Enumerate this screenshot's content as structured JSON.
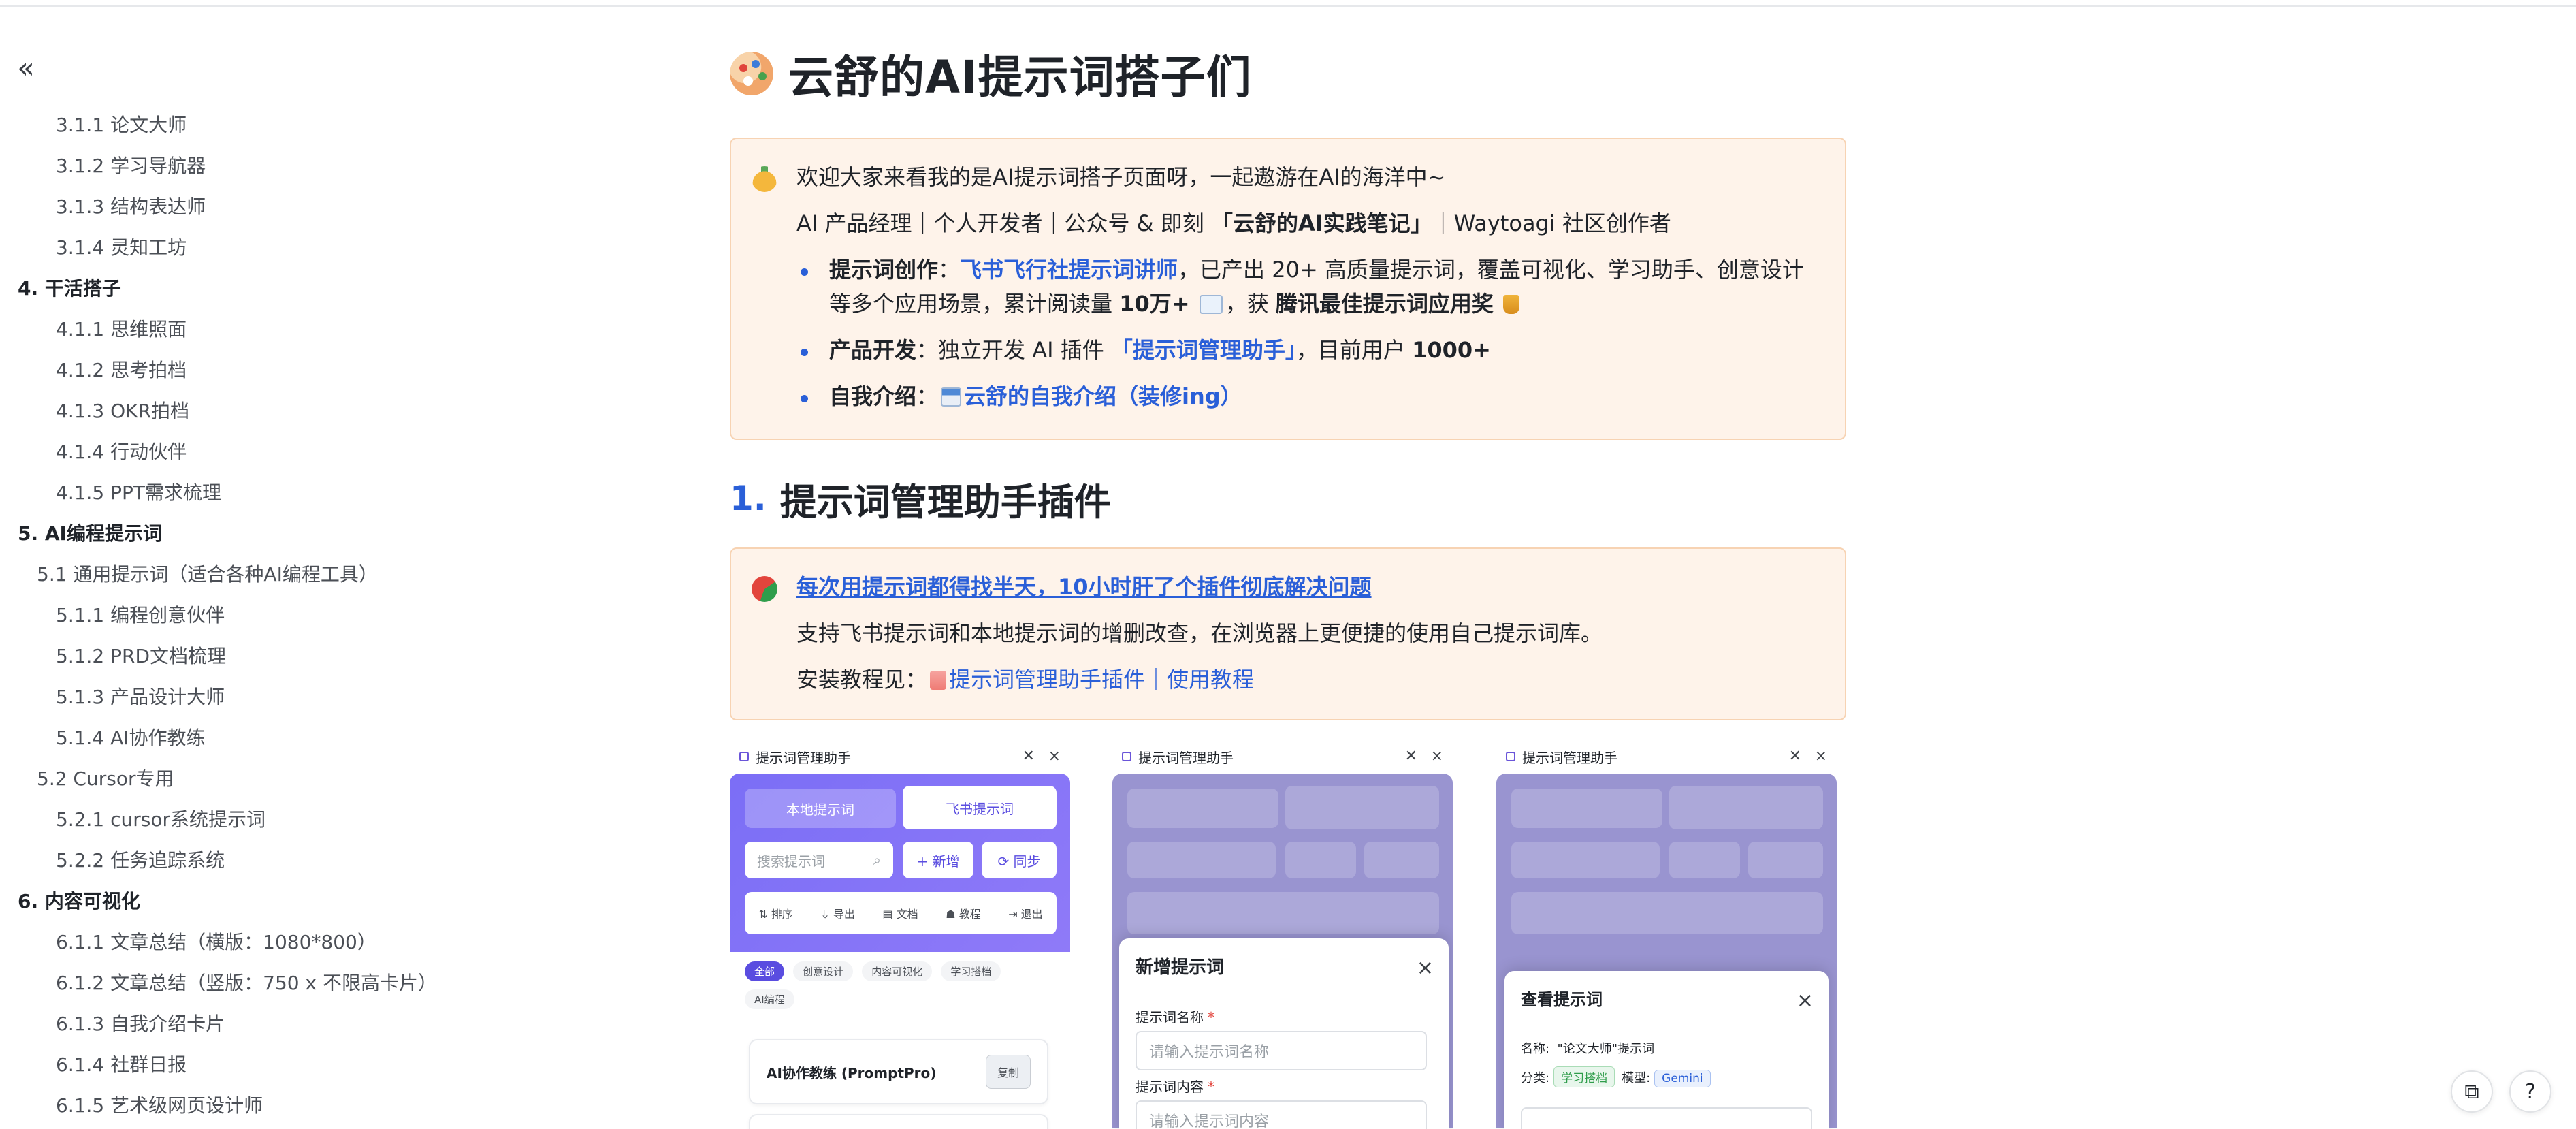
{
  "toc": {
    "collapse_glyph": "«",
    "items": [
      {
        "label": "3.1.1 论文大师",
        "level": 3
      },
      {
        "label": "3.1.2 学习导航器",
        "level": 3
      },
      {
        "label": "3.1.3 结构表达师",
        "level": 3
      },
      {
        "label": "3.1.4 灵知工坊",
        "level": 3
      },
      {
        "label": "4. 干活搭子",
        "level": 1
      },
      {
        "label": "4.1.1 思维照面",
        "level": 3
      },
      {
        "label": "4.1.2 思考拍档",
        "level": 3
      },
      {
        "label": "4.1.3 OKR拍档",
        "level": 3
      },
      {
        "label": "4.1.4 行动伙伴",
        "level": 3
      },
      {
        "label": "4.1.5 PPT需求梳理",
        "level": 3
      },
      {
        "label": "5. AI编程提示词",
        "level": 1
      },
      {
        "label": "5.1 通用提示词（适合各种AI编程工具）",
        "level": 2
      },
      {
        "label": "5.1.1 编程创意伙伴",
        "level": 3
      },
      {
        "label": "5.1.2 PRD文档梳理",
        "level": 3
      },
      {
        "label": "5.1.3 产品设计大师",
        "level": 3
      },
      {
        "label": "5.1.4 AI协作教练",
        "level": 3
      },
      {
        "label": "5.2 Cursor专用",
        "level": 2
      },
      {
        "label": "5.2.1 cursor系统提示词",
        "level": 3
      },
      {
        "label": "5.2.2 任务追踪系统",
        "level": 3
      },
      {
        "label": "6. 内容可视化",
        "level": 1
      },
      {
        "label": "6.1.1 文章总结（横版：1080*800）",
        "level": 3
      },
      {
        "label": "6.1.2 文章总结（竖版：750 x 不限高卡片）",
        "level": 3
      },
      {
        "label": "6.1.3 自我介绍卡片",
        "level": 3
      },
      {
        "label": "6.1.4 社群日报",
        "level": 3
      },
      {
        "label": "6.1.5 艺术级网页设计师",
        "level": 3
      }
    ]
  },
  "page": {
    "title": "云舒的AI提示词搭子们",
    "intro": {
      "welcome": "欢迎大家来看我的是AI提示词搭子页面呀，一起遨游在AI的海洋中~",
      "roles_prefix": "AI 产品经理｜个人开发者｜公众号 & 即刻 ",
      "roles_bold": "「云舒的AI实践笔记」",
      "roles_suffix": "｜Waytoagi 社区创作者",
      "b1_label": "提示词创作",
      "b1_sep": "：",
      "b1_link": "飞书飞行社提示词讲师",
      "b1_text": "，已产出 20+ 高质量提示词，覆盖可视化、学习助手、创意设计",
      "b1_text2": "等多个应用场景，累计阅读量 ",
      "b1_reads": "10万+",
      "b1_text3": "，获 ",
      "b1_award": "腾讯最佳提示词应用奖",
      "b2_label": "产品开发",
      "b2_text": "：独立开发 AI 插件 ",
      "b2_link": "「提示词管理助手」",
      "b2_text2": "，目前用户 ",
      "b2_users": "1000+",
      "b3_label": "自我介绍",
      "b3_text": "：",
      "b3_link": "云舒的自我介绍（装修ing）"
    },
    "section1": {
      "num": "1.",
      "title": "提示词管理助手插件",
      "callout_link": "每次用提示词都得找半天，10小时肝了个插件彻底解决问题",
      "desc": "支持飞书提示词和本地提示词的增删改查，在浏览器上更便捷的使用自己提示词库。",
      "tutorial_prefix": "安装教程见：",
      "tutorial_link": "提示词管理助手插件｜使用教程"
    }
  },
  "plugin": {
    "window_title": "提示词管理助手",
    "pin_glyph": "✕",
    "close_glyph": "×",
    "tab_local": "本地提示词",
    "tab_feishu": "飞书提示词",
    "search_placeholder": "搜索提示词",
    "btn_add": "+ 新增",
    "btn_sync": "⟳ 同步",
    "tools": [
      "⇅ 排序",
      "⇩ 导出",
      "▤ 文档",
      "☗ 教程",
      "⇥ 退出"
    ],
    "tags": [
      "全部",
      "创意设计",
      "内容可视化",
      "学习搭档",
      "AI编程"
    ],
    "card1_title": "AI协作教练 (PromptPro)",
    "card1_copy": "复制",
    "modal_new": {
      "title": "新增提示词",
      "name_label": "提示词名称",
      "name_placeholder": "请输入提示词名称",
      "content_label": "提示词内容",
      "content_placeholder": "请输入提示词内容",
      "req": "*"
    },
    "modal_view": {
      "title": "查看提示词",
      "name_label": "名称:",
      "name_value": "\"论文大师\"提示词",
      "cat_label": "分类:",
      "cat_value": "学习搭档",
      "model_label": "模型:",
      "model_value": "Gemini"
    }
  },
  "fabs": {
    "copy_glyph": "⧉",
    "help_glyph": "?"
  }
}
